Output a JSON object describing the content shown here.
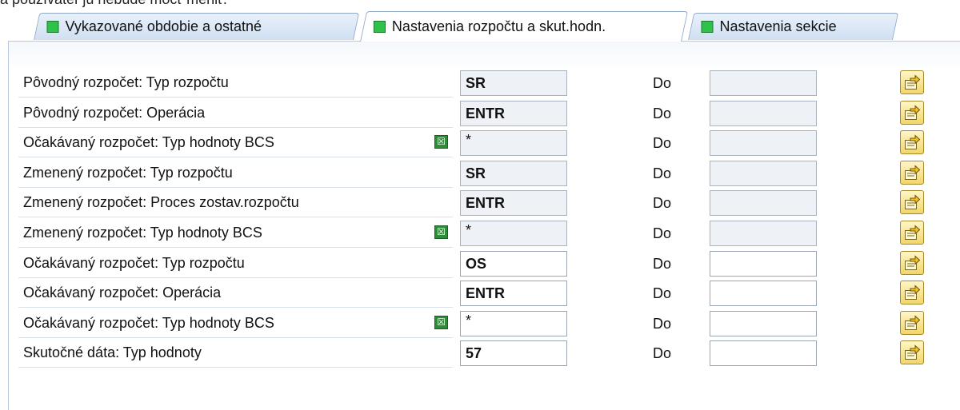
{
  "top_text": "a používateľ ju nebude môcť meniť.",
  "tabs": [
    {
      "label": "Vykazované obdobie a ostatné",
      "active": false
    },
    {
      "label": "Nastavenia rozpočtu a skut.hodn.",
      "active": true
    },
    {
      "label": "Nastavenia sekcie",
      "active": false
    }
  ],
  "do_label": "Do",
  "rows": [
    {
      "label": "Pôvodný rozpočet: Typ rozpočtu",
      "from": "SR",
      "to": "",
      "readonly": true,
      "multi": false
    },
    {
      "label": "Pôvodný rozpočet: Operácia",
      "from": "ENTR",
      "to": "",
      "readonly": true,
      "multi": false
    },
    {
      "label": "Očakávaný rozpočet: Typ hodnoty BCS",
      "from": "*",
      "to": "",
      "readonly": true,
      "multi": true
    },
    {
      "label": "Zmenený rozpočet: Typ rozpočtu",
      "from": "SR",
      "to": "",
      "readonly": true,
      "multi": false
    },
    {
      "label": "Zmenený rozpočet: Proces zostav.rozpočtu",
      "from": "ENTR",
      "to": "",
      "readonly": true,
      "multi": false
    },
    {
      "label": "Zmenený rozpočet: Typ hodnoty BCS",
      "from": "*",
      "to": "",
      "readonly": true,
      "multi": true
    },
    {
      "label": "Očakávaný rozpočet: Typ rozpočtu",
      "from": "OS",
      "to": "",
      "readonly": false,
      "multi": false
    },
    {
      "label": "Očakávaný rozpočet: Operácia",
      "from": "ENTR",
      "to": "",
      "readonly": false,
      "multi": false
    },
    {
      "label": "Očakávaný rozpočet: Typ hodnoty BCS",
      "from": "*",
      "to": "",
      "readonly": false,
      "multi": true
    },
    {
      "label": "Skutočné dáta: Typ hodnoty",
      "from": "57",
      "to": "",
      "readonly": false,
      "multi": false
    }
  ],
  "icons": {
    "multi_select": "multiple-selection-icon",
    "arrow": "multiple-selection-arrow-icon",
    "tab_status": "green-status-icon"
  },
  "colors": {
    "led_green": "#2fc24a",
    "button_yellow": "#f2d66a",
    "readonly_bg": "#eef1f5"
  }
}
